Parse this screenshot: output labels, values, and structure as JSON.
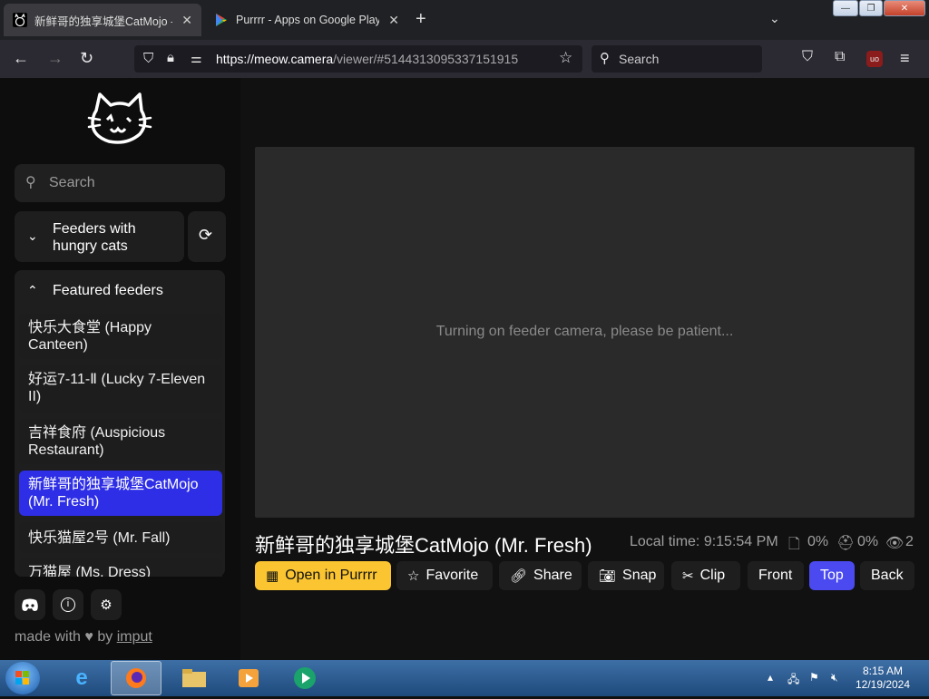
{
  "browser": {
    "tabs": [
      {
        "title": "新鲜哥的独享城堡CatMojo - m",
        "active": true
      },
      {
        "title": "Purrrr - Apps on Google Play",
        "active": false
      }
    ],
    "new_tab": "+",
    "url_host": "https://meow.camera",
    "url_path": "/viewer/#5144313095337151915",
    "search_placeholder": "Search"
  },
  "sidebar": {
    "search_placeholder": "Search",
    "hungry_section": "Feeders with hungry cats",
    "featured_section": "Featured feeders",
    "feeders": [
      {
        "name": "快乐大食堂 (Happy Canteen)",
        "selected": false
      },
      {
        "name": "好运7-11-Ⅱ (Lucky 7-Eleven II)",
        "selected": false
      },
      {
        "name": "吉祥食府 (Auspicious Restaurant)",
        "selected": false
      },
      {
        "name": "新鲜哥的独享城堡CatMojo (Mr. Fresh)",
        "selected": true
      },
      {
        "name": "快乐猫屋2号 (Mr. Fall)",
        "selected": false
      },
      {
        "name": "万猫屋 (Ms. Dress)",
        "selected": false
      }
    ],
    "made_with": "made with",
    "by": "by",
    "author": "imput"
  },
  "viewer": {
    "status_message": "Turning on feeder camera, please be patient...",
    "feeder_title": "新鲜哥的独享城堡CatMojo (Mr. Fresh)",
    "local_time": "Local time: 9:15:54 PM",
    "food_level": "0%",
    "treat_level": "0%",
    "viewers": "2"
  },
  "actions": {
    "open": "Open in Purrrr",
    "favorite": "Favorite",
    "share": "Share",
    "snap": "Snap",
    "clip": "Clip",
    "front": "Front",
    "top": "Top",
    "back": "Back"
  },
  "taskbar": {
    "time": "8:15 AM",
    "date": "12/19/2024"
  },
  "colors": {
    "accent_blue": "#2e2ee6",
    "button_yellow": "#fbc531",
    "active_view": "#4a4af0"
  }
}
